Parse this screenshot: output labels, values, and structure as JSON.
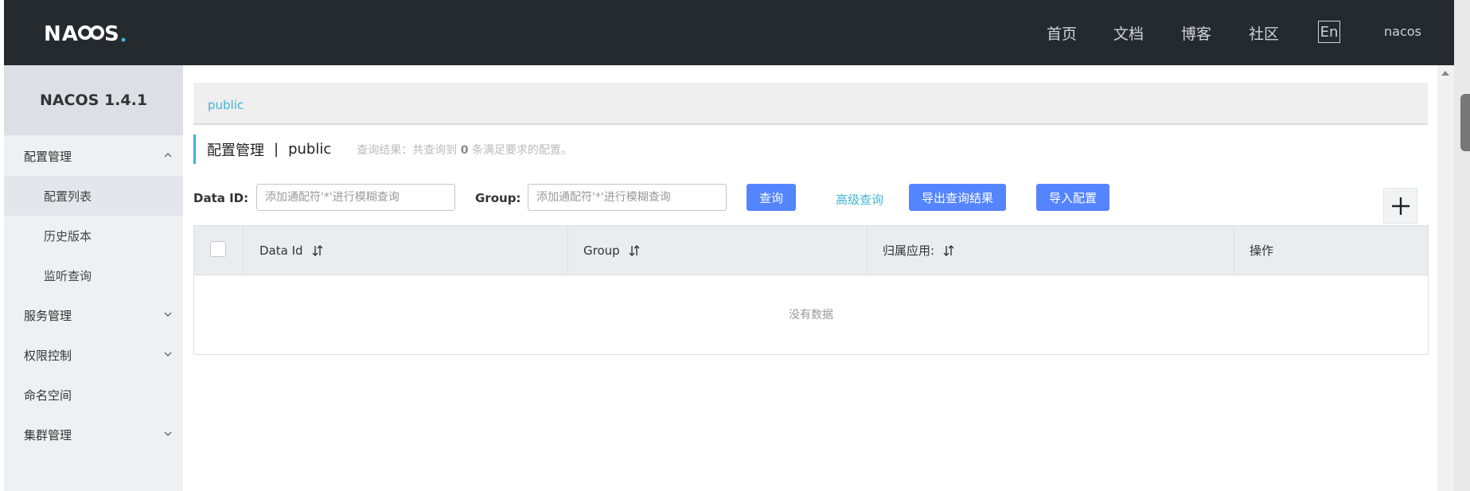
{
  "header": {
    "logo_text": "NACOS.",
    "nav": [
      "首页",
      "文档",
      "博客",
      "社区"
    ],
    "lang_button": "En",
    "user": "nacos"
  },
  "sidebar": {
    "version": "NACOS 1.4.1",
    "groups": [
      {
        "label": "配置管理",
        "expanded": true
      },
      {
        "label": "服务管理",
        "expanded": false
      },
      {
        "label": "权限控制",
        "expanded": false
      },
      {
        "label": "命名空间"
      },
      {
        "label": "集群管理",
        "expanded": false
      }
    ],
    "config_items": [
      "配置列表",
      "历史版本",
      "监听查询"
    ]
  },
  "namespace": {
    "current": "public"
  },
  "page": {
    "title": "配置管理",
    "separator": "|",
    "namespace": "public",
    "result_prefix": "查询结果：共查询到",
    "result_count": "0",
    "result_suffix": "条满足要求的配置。"
  },
  "search": {
    "dataid_label": "Data ID:",
    "dataid_placeholder": "添加通配符'*'进行模糊查询",
    "group_label": "Group:",
    "group_placeholder": "添加通配符'*'进行模糊查询",
    "query_button": "查询",
    "advanced_link": "高级查询",
    "export_button": "导出查询结果",
    "import_button": "导入配置"
  },
  "table": {
    "columns": [
      "Data Id",
      "Group",
      "归属应用:",
      "操作"
    ],
    "empty_text": "没有数据"
  },
  "colors": {
    "header_bg": "#252a2f",
    "accent": "#3fb4d8",
    "primary_button": "#5584ff",
    "sidebar_bg": "#eef0f3"
  }
}
